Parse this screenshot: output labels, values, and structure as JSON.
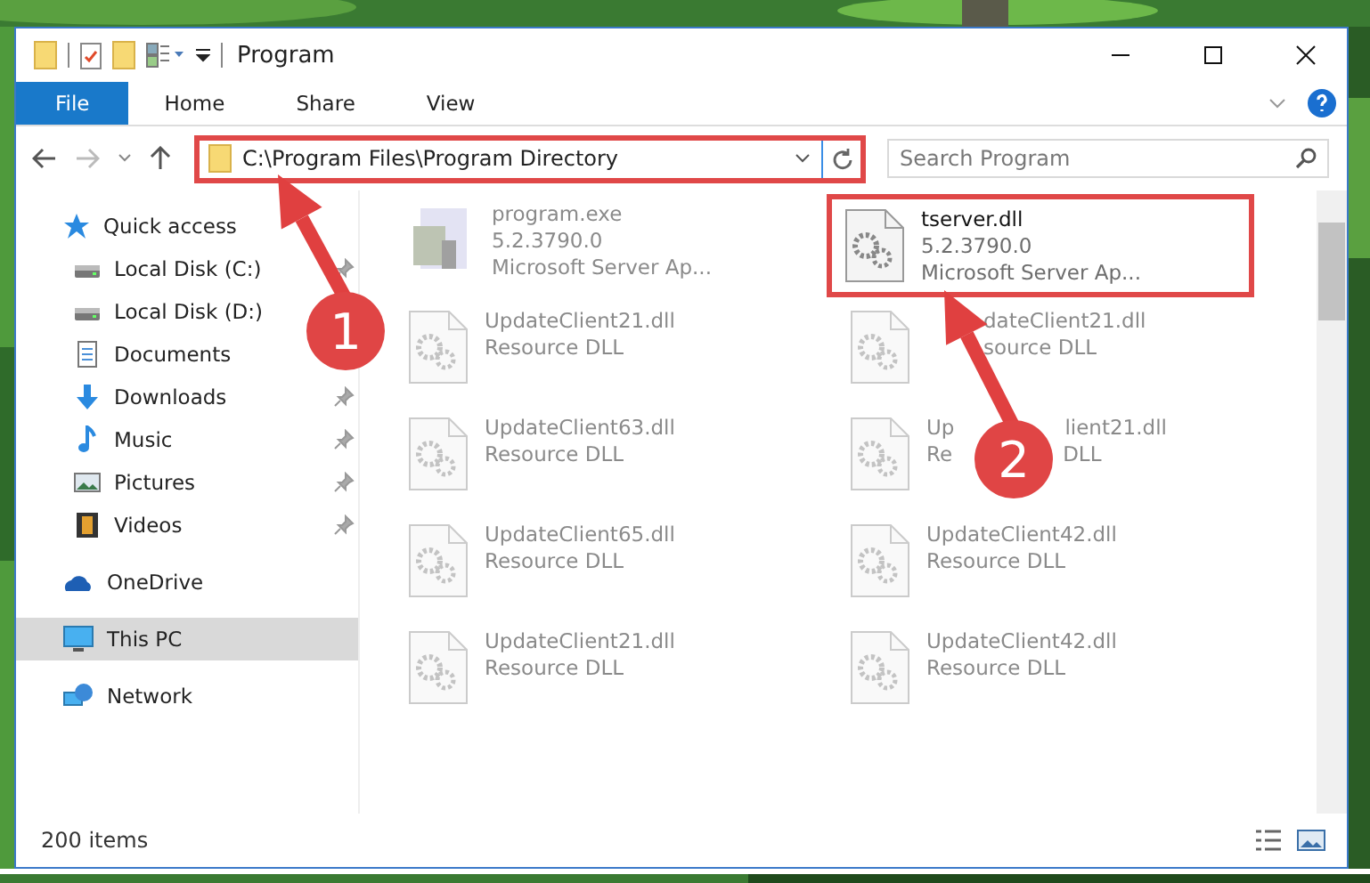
{
  "window": {
    "title": "Program"
  },
  "ribbon": {
    "tabs": [
      {
        "label": "File",
        "selected": true
      },
      {
        "label": "Home",
        "selected": false
      },
      {
        "label": "Share",
        "selected": false
      },
      {
        "label": "View",
        "selected": false
      }
    ]
  },
  "address": {
    "path": "C:\\Program Files\\Program Directory",
    "highlighted": true
  },
  "search": {
    "placeholder": "Search Program"
  },
  "sidebar": {
    "items": [
      {
        "label": "Quick access",
        "kind": "star",
        "selected": false,
        "children": [
          {
            "label": "Local Disk (C:)",
            "kind": "drive",
            "pinned": true,
            "selected": false
          },
          {
            "label": "Local Disk (D:)",
            "kind": "drive",
            "pinned": false,
            "selected": false
          },
          {
            "label": "Documents",
            "kind": "document",
            "pinned": false,
            "selected": false
          },
          {
            "label": "Downloads",
            "kind": "download",
            "pinned": true,
            "selected": false
          },
          {
            "label": "Music",
            "kind": "music",
            "pinned": true,
            "selected": false
          },
          {
            "label": "Pictures",
            "kind": "pictures",
            "pinned": true,
            "selected": false
          },
          {
            "label": "Videos",
            "kind": "videos",
            "pinned": true,
            "selected": false
          }
        ]
      },
      {
        "label": "OneDrive",
        "kind": "cloud",
        "selected": false
      },
      {
        "label": "This PC",
        "kind": "pc",
        "selected": true
      },
      {
        "label": "Network",
        "kind": "network",
        "selected": false
      }
    ]
  },
  "files": [
    {
      "lines": [
        [
          "program.exe"
        ],
        [
          "5.2.3790.0"
        ],
        [
          "Microsoft Server Ap..."
        ]
      ],
      "kind": "exe",
      "dimmed": true,
      "highlighted": false
    },
    {
      "lines": [
        [
          "tserver.dll"
        ],
        [
          "5.2.3790.0"
        ],
        [
          "Microsoft Server Ap..."
        ]
      ],
      "kind": "dll",
      "dimmed": false,
      "highlighted": true
    },
    {
      "lines": [
        [
          "UpdateClient21.dll"
        ],
        [
          "Resource DLL"
        ]
      ],
      "kind": "dll",
      "dimmed": true,
      "highlighted": false
    },
    {
      "lines": [
        [
          "dateClient21.dll"
        ],
        [
          "source DLL"
        ]
      ],
      "kind": "dll",
      "dimmed": true,
      "highlighted": false,
      "covered_start": true
    },
    {
      "lines": [
        [
          "UpdateClient63.dll"
        ],
        [
          "Resource DLL"
        ]
      ],
      "kind": "dll",
      "dimmed": true,
      "highlighted": false
    },
    {
      "lines": [
        [
          "Up",
          "lient21.dll"
        ],
        [
          "Re",
          "DLL"
        ]
      ],
      "kind": "dll",
      "dimmed": true,
      "highlighted": false,
      "covered_middle": true
    },
    {
      "lines": [
        [
          "UpdateClient65.dll"
        ],
        [
          "Resource DLL"
        ]
      ],
      "kind": "dll",
      "dimmed": true,
      "highlighted": false
    },
    {
      "lines": [
        [
          "UpdateClient42.dll"
        ],
        [
          "Resource DLL"
        ]
      ],
      "kind": "dll",
      "dimmed": true,
      "highlighted": false
    },
    {
      "lines": [
        [
          "UpdateClient21.dll"
        ],
        [
          "Resource DLL"
        ]
      ],
      "kind": "dll",
      "dimmed": true,
      "highlighted": false
    },
    {
      "lines": [
        [
          "UpdateClient42.dll"
        ],
        [
          "Resource DLL"
        ]
      ],
      "kind": "dll",
      "dimmed": true,
      "highlighted": false
    }
  ],
  "status_bar": {
    "item_count": "200 items"
  },
  "annotations": [
    {
      "number": "1"
    },
    {
      "number": "2"
    }
  ]
}
